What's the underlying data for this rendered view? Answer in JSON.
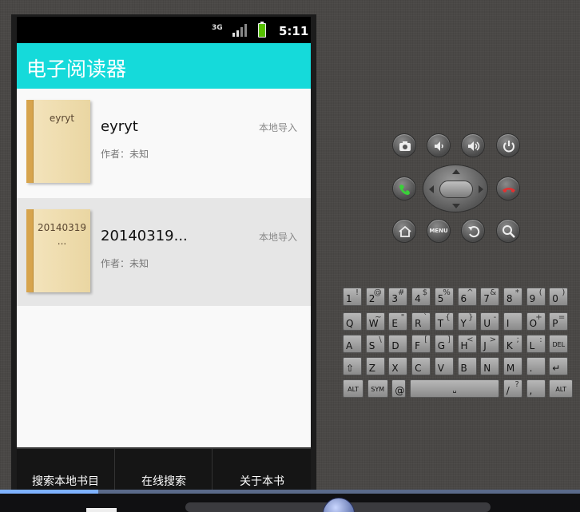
{
  "status_bar": {
    "network": "3G",
    "time": "5:11"
  },
  "app": {
    "title": "电子阅读器"
  },
  "books": [
    {
      "cover_text": "eyryt",
      "cover_ellipsis": "",
      "name": "eyryt",
      "author": "作者：未知",
      "source": "本地导入"
    },
    {
      "cover_text": "20140319",
      "cover_ellipsis": "...",
      "name": "20140319...",
      "author": "作者：未知",
      "source": "本地导入"
    }
  ],
  "bottom_menu": {
    "search_local": "搜索本地书目",
    "online_search": "在线搜索",
    "about_book": "关于本书"
  },
  "hardware_buttons": [
    "camera-icon",
    "volume-down-icon",
    "volume-up-icon",
    "power-icon",
    "call-icon",
    "dpad",
    "end-call-icon",
    "home-icon",
    "menu-button",
    "back-icon",
    "search-icon"
  ],
  "hardware": {
    "menu_label": "MENU"
  },
  "keyboard": {
    "row1": [
      [
        "1",
        "!"
      ],
      [
        "2",
        "@"
      ],
      [
        "3",
        "#"
      ],
      [
        "4",
        "$"
      ],
      [
        "5",
        "%"
      ],
      [
        "6",
        "^"
      ],
      [
        "7",
        "&"
      ],
      [
        "8",
        "*"
      ],
      [
        "9",
        "("
      ],
      [
        "0",
        ")"
      ]
    ],
    "row2": [
      [
        "Q",
        ""
      ],
      [
        "W",
        "~"
      ],
      [
        "E",
        "\""
      ],
      [
        "R",
        "`"
      ],
      [
        "T",
        "{"
      ],
      [
        "Y",
        "}"
      ],
      [
        "U",
        "-"
      ],
      [
        "I",
        ""
      ],
      [
        "O",
        "+"
      ],
      [
        "P",
        "="
      ]
    ],
    "row3": [
      [
        "A",
        ""
      ],
      [
        "S",
        "\\"
      ],
      [
        "D",
        ""
      ],
      [
        "F",
        "["
      ],
      [
        "G",
        "]"
      ],
      [
        "H",
        "<"
      ],
      [
        "J",
        ">"
      ],
      [
        "K",
        ";"
      ],
      [
        "L",
        ":"
      ],
      [
        "DEL",
        ""
      ]
    ],
    "row4": [
      [
        "⇧",
        ""
      ],
      [
        "Z",
        ""
      ],
      [
        "X",
        ""
      ],
      [
        "C",
        ""
      ],
      [
        "V",
        ""
      ],
      [
        "B",
        ""
      ],
      [
        "N",
        ""
      ],
      [
        "M",
        ""
      ],
      [
        ".",
        ""
      ],
      [
        "↵",
        ""
      ]
    ],
    "row5": [
      [
        "ALT",
        ""
      ],
      [
        "SYM",
        ""
      ],
      [
        "@",
        ""
      ],
      [
        "␣",
        ""
      ],
      [
        "/",
        "?"
      ],
      [
        ",",
        ""
      ],
      [
        "ALT",
        ""
      ]
    ]
  },
  "colors": {
    "title_bar": "#15dada",
    "selected_row": "#e6e6e6",
    "battery": "#56c000"
  },
  "media": {
    "progress": 0.17
  }
}
